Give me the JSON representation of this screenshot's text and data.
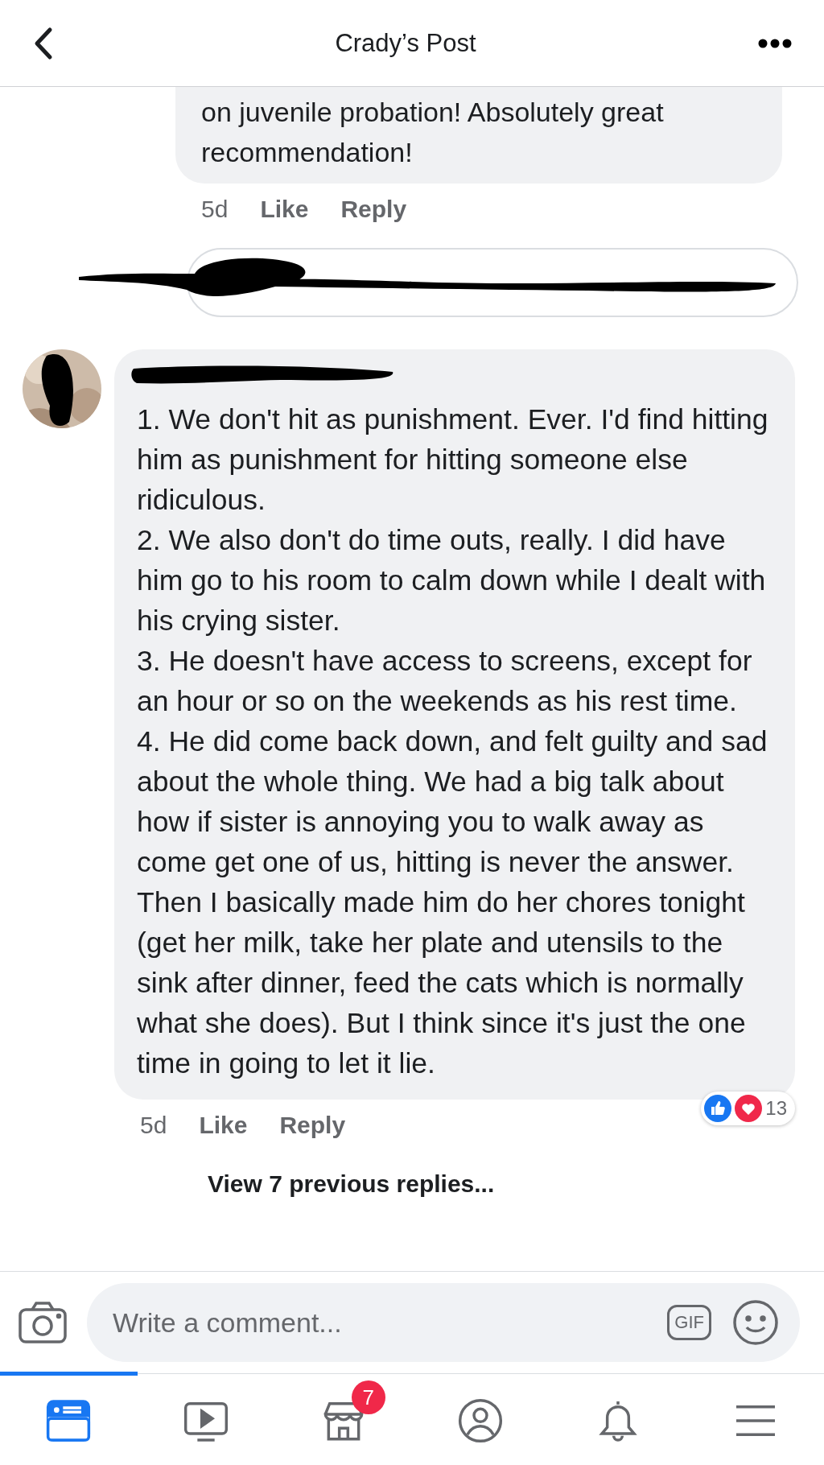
{
  "header": {
    "title": "Crady’s Post"
  },
  "previous_comment": {
    "text": "on juvenile probation! Absolutely great recommendation!",
    "time": "5d",
    "actions": [
      "Like",
      "Reply"
    ]
  },
  "comment": {
    "paragraphs": [
      "1. We don't hit as punishment. Ever. I'd find hitting him as punishment for hitting someone else ridiculous.",
      "2. We also don't do time outs, really. I did have him go to his room to calm down while I dealt with his crying sister.",
      "3. He doesn't have access to screens, except for an hour or so on the weekends as his rest time.",
      "4. He did come back down, and felt guilty and sad about the whole thing. We had a big talk about how if sister is annoying you to walk away as come get one of us, hitting is never the answer. Then I basically made him do her chores tonight (get her milk, take her plate and utensils to the sink after dinner, feed the cats which is normally what she does). But I think since it's just the one time in going to let it lie."
    ],
    "time": "5d",
    "actions": [
      "Like",
      "Reply"
    ],
    "reaction_count": "13"
  },
  "view_previous": "View 7 previous replies...",
  "composer": {
    "placeholder": "Write a comment...",
    "gif_label": "GIF"
  },
  "tab_bar": [
    {
      "kind": "feed",
      "selected": true
    },
    {
      "kind": "watch",
      "selected": false
    },
    {
      "kind": "marketplace",
      "selected": false,
      "badge": "7"
    },
    {
      "kind": "profile",
      "selected": false
    },
    {
      "kind": "notifications",
      "selected": false
    },
    {
      "kind": "menu",
      "selected": false
    }
  ]
}
